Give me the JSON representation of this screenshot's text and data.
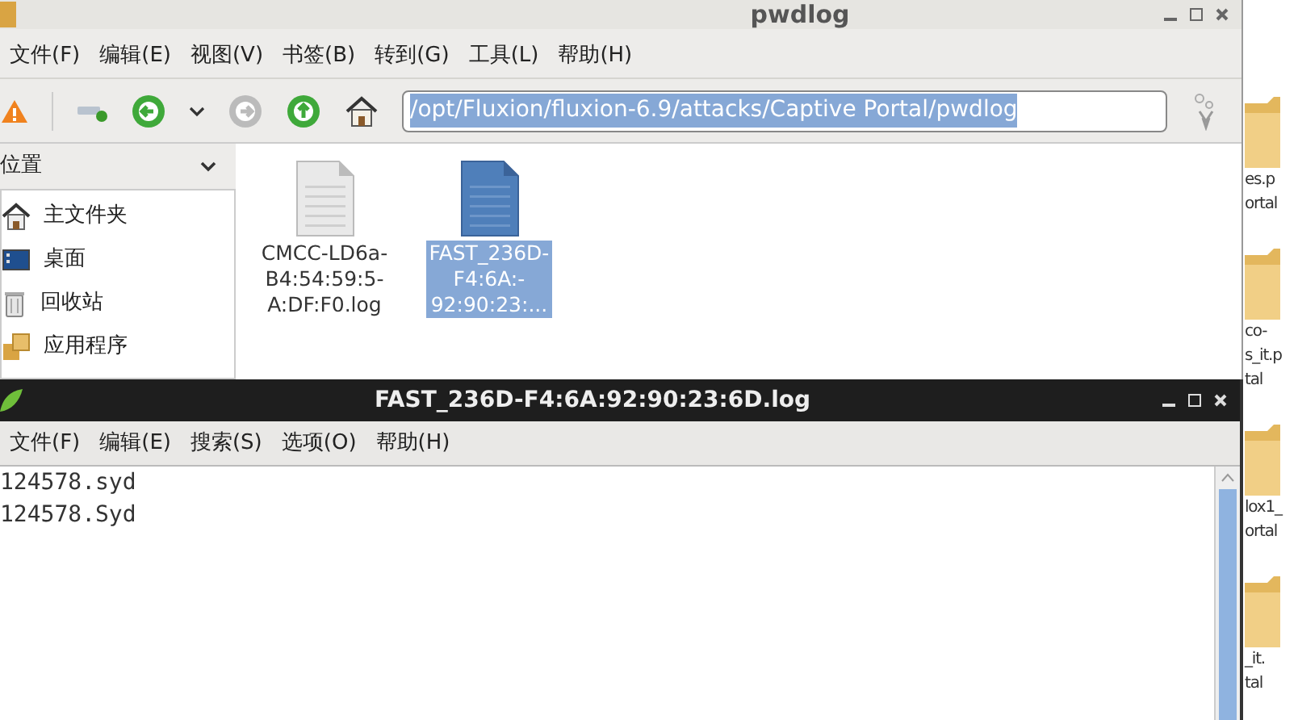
{
  "file_manager": {
    "window_title": "pwdlog",
    "menu": [
      "文件(F)",
      "编辑(E)",
      "视图(V)",
      "书签(B)",
      "转到(G)",
      "工具(L)",
      "帮助(H)"
    ],
    "toolbar": [
      {
        "kind": "warning",
        "disabled": false
      },
      {
        "kind": "bookmark",
        "disabled": false
      },
      {
        "kind": "back",
        "disabled": false
      },
      {
        "kind": "history",
        "disabled": false
      },
      {
        "kind": "forward",
        "disabled": true
      },
      {
        "kind": "up",
        "disabled": false
      },
      {
        "kind": "home",
        "disabled": false
      }
    ],
    "location": {
      "value": "/opt/Fluxion/fluxion-6.9/attacks/Captive Portal/pwdlog",
      "selected": true
    },
    "sidebar": {
      "title": "位置",
      "items": [
        {
          "label": "主文件夹",
          "kind": "home"
        },
        {
          "label": "桌面",
          "kind": "desktop"
        },
        {
          "label": "回收站",
          "kind": "trash"
        },
        {
          "label": "应用程序",
          "kind": "apps"
        }
      ]
    },
    "files": [
      {
        "lines": [
          "CMCC-LD6a-",
          "B4:54:59:5-",
          "A:DF:F0.log"
        ],
        "selected": false
      },
      {
        "lines": [
          "FAST_236D-",
          "F4:6A:-",
          "92:90:23:..."
        ],
        "selected": true
      }
    ]
  },
  "editor": {
    "window_title": "FAST_236D-F4:6A:92:90:23:6D.log",
    "menu": [
      "文件(F)",
      "编辑(E)",
      "搜索(S)",
      "选项(O)",
      "帮助(H)"
    ],
    "lines": [
      "124578.syd",
      "124578.Syd"
    ]
  },
  "desktop": {
    "icons": [
      {
        "lines": [
          "es.p",
          "ortal"
        ]
      },
      {
        "lines": [
          "co-",
          "s_it.p",
          "tal"
        ]
      },
      {
        "lines": [
          "lox1_",
          "ortal"
        ]
      },
      {
        "lines": [
          "_it.",
          "tal"
        ]
      }
    ]
  }
}
